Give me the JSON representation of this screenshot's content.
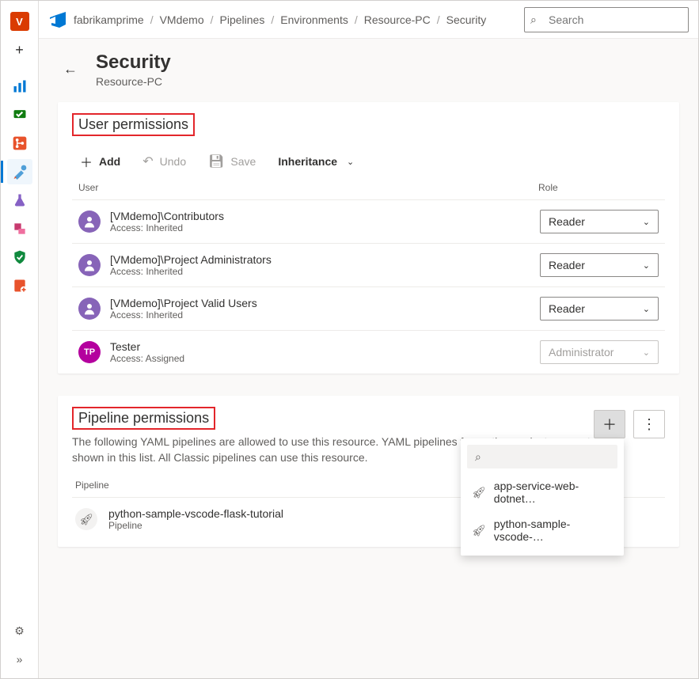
{
  "breadcrumb": [
    "fabrikamprime",
    "VMdemo",
    "Pipelines",
    "Environments",
    "Resource-PC",
    "Security"
  ],
  "search": {
    "placeholder": "Search"
  },
  "page": {
    "title": "Security",
    "subtitle": "Resource-PC"
  },
  "userPerms": {
    "title": "User permissions",
    "toolbar": {
      "add": "Add",
      "undo": "Undo",
      "save": "Save",
      "inheritance": "Inheritance"
    },
    "headers": {
      "user": "User",
      "role": "Role"
    },
    "rows": [
      {
        "name": "[VMdemo]\\Contributors",
        "access": "Access: Inherited",
        "role": "Reader",
        "avatar": "group",
        "disabled": false
      },
      {
        "name": "[VMdemo]\\Project Administrators",
        "access": "Access: Inherited",
        "role": "Reader",
        "avatar": "group",
        "disabled": false
      },
      {
        "name": "[VMdemo]\\Project Valid Users",
        "access": "Access: Inherited",
        "role": "Reader",
        "avatar": "group",
        "disabled": false
      },
      {
        "name": "Tester",
        "access": "Access: Assigned",
        "role": "Administrator",
        "avatar": "TP",
        "avatarColor": "#b4009e",
        "disabled": true
      }
    ]
  },
  "pipePerms": {
    "title": "Pipeline permissions",
    "desc": "The following YAML pipelines are allowed to use this resource. YAML pipelines from other projects are not shown in this list. All Classic pipelines can use this resource.",
    "headerLabel": "Pipeline",
    "rows": [
      {
        "name": "python-sample-vscode-flask-tutorial",
        "sub": "Pipeline"
      }
    ],
    "popupItems": [
      "app-service-web-dotnet…",
      "python-sample-vscode-…"
    ]
  },
  "navTile": {
    "letter": "V",
    "bg": "#da3b01"
  }
}
